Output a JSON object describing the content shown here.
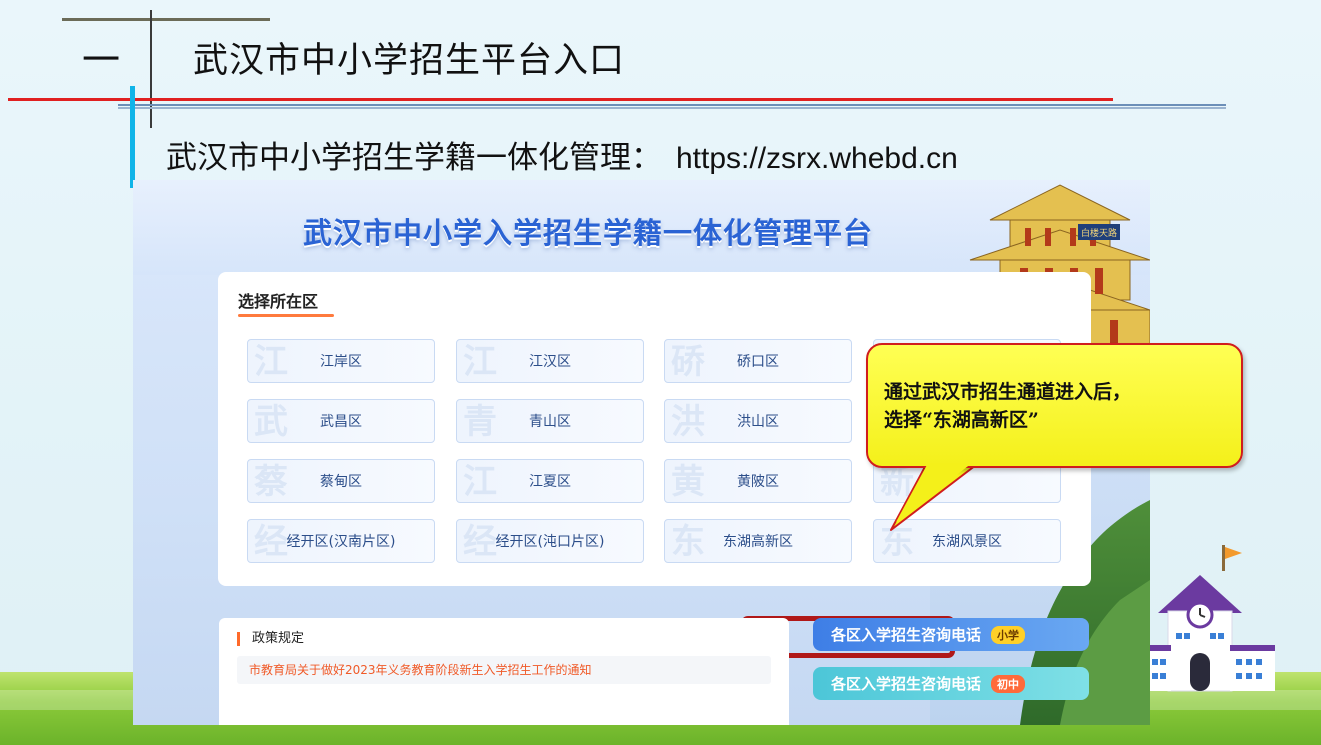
{
  "slide": {
    "number": "一",
    "title": "武汉市中小学招生平台入口",
    "subtitle_label": "武汉市中小学招生学籍一体化管理：",
    "subtitle_url": "https://zsrx.whebd.cn"
  },
  "platform": {
    "title": "武汉市中小学入学招生学籍一体化管理平台",
    "tower_sign": "白楼天路",
    "region_section": {
      "heading": "选择所在区",
      "regions": [
        {
          "label": "江岸区",
          "ghost": "江"
        },
        {
          "label": "江汉区",
          "ghost": "江"
        },
        {
          "label": "硚口区",
          "ghost": "硚"
        },
        {
          "label": "",
          "ghost": ""
        },
        {
          "label": "武昌区",
          "ghost": "武"
        },
        {
          "label": "青山区",
          "ghost": "青"
        },
        {
          "label": "洪山区",
          "ghost": "洪"
        },
        {
          "label": "",
          "ghost": ""
        },
        {
          "label": "蔡甸区",
          "ghost": "蔡"
        },
        {
          "label": "江夏区",
          "ghost": "江"
        },
        {
          "label": "黄陂区",
          "ghost": "黄"
        },
        {
          "label": "",
          "ghost": "新"
        },
        {
          "label": "经开区(汉南片区)",
          "ghost": "经"
        },
        {
          "label": "经开区(沌口片区)",
          "ghost": "经"
        },
        {
          "label": "东湖高新区",
          "ghost": "东"
        },
        {
          "label": "东湖风景区",
          "ghost": "东"
        }
      ],
      "highlighted": "东湖高新区"
    },
    "policy": {
      "heading": "政策规定",
      "link": "市教育局关于做好2023年义务教育阶段新生入学招生工作的通知"
    },
    "phones": {
      "primary_label": "各区入学招生咨询电话",
      "primary_badge": "小学",
      "junior_label": "各区入学招生咨询电话",
      "junior_badge": "初中"
    }
  },
  "callout": {
    "line1": "通过武汉市招生通道进入后，",
    "line2": "选择“东湖高新区”"
  },
  "colors": {
    "accent_red": "#e02020",
    "platform_blue": "#2a63d4",
    "callout_yellow": "#ffff54",
    "highlight_red": "#b01818"
  }
}
